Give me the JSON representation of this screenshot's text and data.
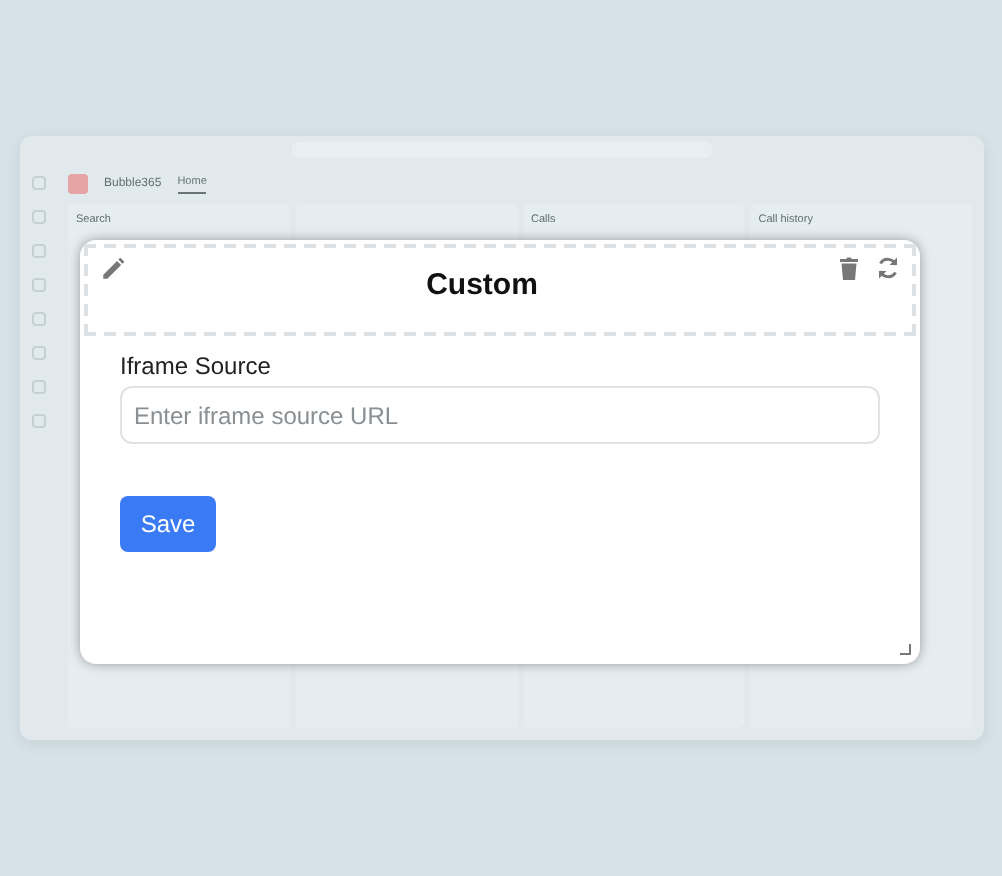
{
  "background_app": {
    "brand": "Bubble365",
    "nav_tabs": [
      {
        "label": "Home",
        "selected": true
      }
    ],
    "panels": [
      {
        "title": "Search"
      },
      {
        "title": "Calls"
      },
      {
        "title": "Call history"
      }
    ]
  },
  "modal": {
    "title": "Custom",
    "field": {
      "label": "Iframe Source",
      "placeholder": "Enter iframe source URL"
    },
    "save_button": "Save"
  }
}
